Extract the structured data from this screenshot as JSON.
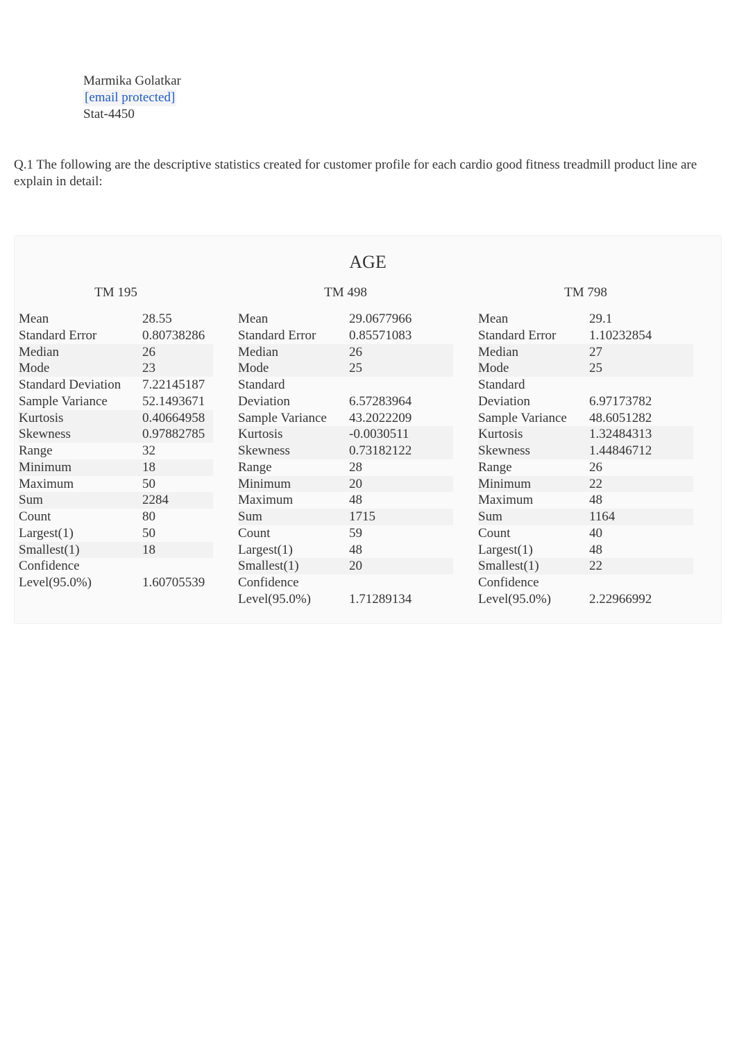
{
  "author": {
    "name": "Marmika Golatkar",
    "email": "[email protected]",
    "course": "Stat-4450"
  },
  "question": "Q.1 The following are the descriptive statistics created for customer profile for each cardio good fitness treadmill product line are explain in detail:",
  "stats": {
    "title": "AGE",
    "row_labels": [
      "Mean",
      "Standard Error",
      "Median",
      "Mode",
      "Standard Deviation",
      "Sample Variance",
      "Kurtosis",
      "Skewness",
      "Range",
      "Minimum",
      "Maximum",
      "Sum",
      "Count",
      "Largest(1)",
      "Smallest(1)",
      "Confidence Level(95.0%)"
    ],
    "row_labels_wrapped": {
      "4": [
        "Standard",
        "Deviation"
      ],
      "15": [
        "Confidence",
        "Level(95.0%)"
      ]
    },
    "columns": [
      {
        "header": "TM 195",
        "values": [
          "28.55",
          "0.80738286",
          "26",
          "23",
          "7.22145187",
          "52.1493671",
          "0.40664958",
          "0.97882785",
          "32",
          "18",
          "50",
          "2284",
          "80",
          "50",
          "18",
          "1.60705539"
        ]
      },
      {
        "header": "TM 498",
        "values": [
          "29.0677966",
          "0.85571083",
          "26",
          "25",
          "6.57283964",
          "43.2022209",
          "-0.0030511",
          "0.73182122",
          "28",
          "20",
          "48",
          "1715",
          "59",
          "48",
          "20",
          "1.71289134"
        ]
      },
      {
        "header": "TM 798",
        "values": [
          "29.1",
          "1.10232854",
          "27",
          "25",
          "6.97173782",
          "48.6051282",
          "1.32484313",
          "1.44846712",
          "26",
          "22",
          "48",
          "1164",
          "40",
          "48",
          "22",
          "2.22966992"
        ]
      }
    ]
  }
}
